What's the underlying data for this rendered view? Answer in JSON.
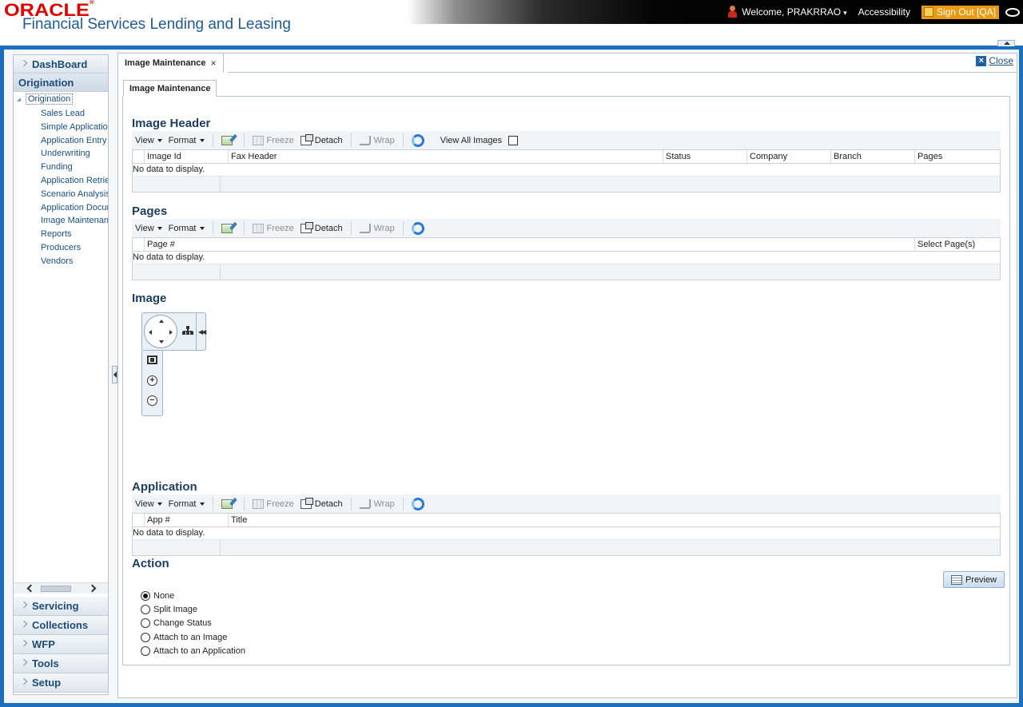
{
  "header": {
    "logo_text": "ORACLE",
    "logo_reg": "®",
    "product_name": "Financial Services Lending and Leasing",
    "welcome": "Welcome, PRAKRRAO",
    "accessibility": "Accessibility",
    "signout": "Sign Out [QA]"
  },
  "leftnav": {
    "dashboard": "DashBoard",
    "origination_header": "Origination",
    "tree_root": "Origination",
    "items": [
      "Sales Lead",
      "Simple Application",
      "Application Entry",
      "Underwriting",
      "Funding",
      "Application Retrieval",
      "Scenario Analysis",
      "Application Document",
      "Image Maintenance",
      "Reports",
      "Producers",
      "Vendors"
    ],
    "bottom": [
      "Servicing",
      "Collections",
      "WFP",
      "Tools",
      "Setup"
    ]
  },
  "content": {
    "outer_tab": "Image Maintenance",
    "close": "Close",
    "inner_tab": "Image Maintenance"
  },
  "toolbar": {
    "view": "View",
    "format": "Format",
    "freeze": "Freeze",
    "detach": "Detach",
    "wrap": "Wrap",
    "view_all_images": "View All Images"
  },
  "image_header": {
    "title": "Image Header",
    "columns": [
      "Image Id",
      "Fax Header",
      "Status",
      "Company",
      "Branch",
      "Pages"
    ],
    "empty": "No data to display."
  },
  "pages": {
    "title": "Pages",
    "columns": [
      "Page #",
      "Select Page(s)"
    ],
    "empty": "No data to display."
  },
  "image": {
    "title": "Image"
  },
  "application": {
    "title": "Application",
    "columns": [
      "App #",
      "Title"
    ],
    "empty": "No data to display."
  },
  "action": {
    "title": "Action",
    "options": [
      "None",
      "Split Image",
      "Change Status",
      "Attach to an Image",
      "Attach to an Application"
    ],
    "selected": "None",
    "preview": "Preview"
  },
  "colors": {
    "frame_blue": "#1b6fc0",
    "oracle_red": "#e00000",
    "signout_orange": "#e89a12",
    "heading_navy": "#1b3d5e"
  }
}
